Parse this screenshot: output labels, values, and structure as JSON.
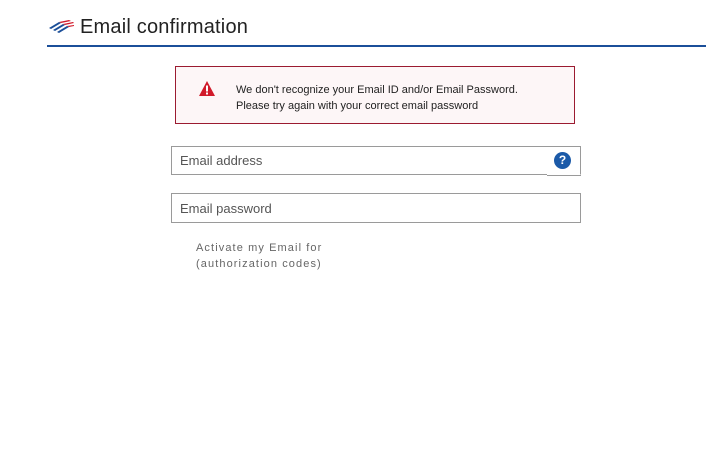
{
  "header": {
    "title": "Email confirmation",
    "logo_icon": "bank-flag-logo"
  },
  "alert": {
    "icon": "warning-triangle-icon",
    "line1": "We don't recognize your Email ID and/or Email Password.",
    "line2": "Please try again  with your correct email password",
    "accent_color": "#9b1b30"
  },
  "form": {
    "email_placeholder": "Email address",
    "password_placeholder": "Email password",
    "help_icon_glyph": "?",
    "activate_link_line1": "Activate my Email for",
    "activate_link_line2": "(authorization codes)"
  },
  "colors": {
    "brand_blue": "#1b4f99",
    "alert_red": "#d11a2a"
  }
}
